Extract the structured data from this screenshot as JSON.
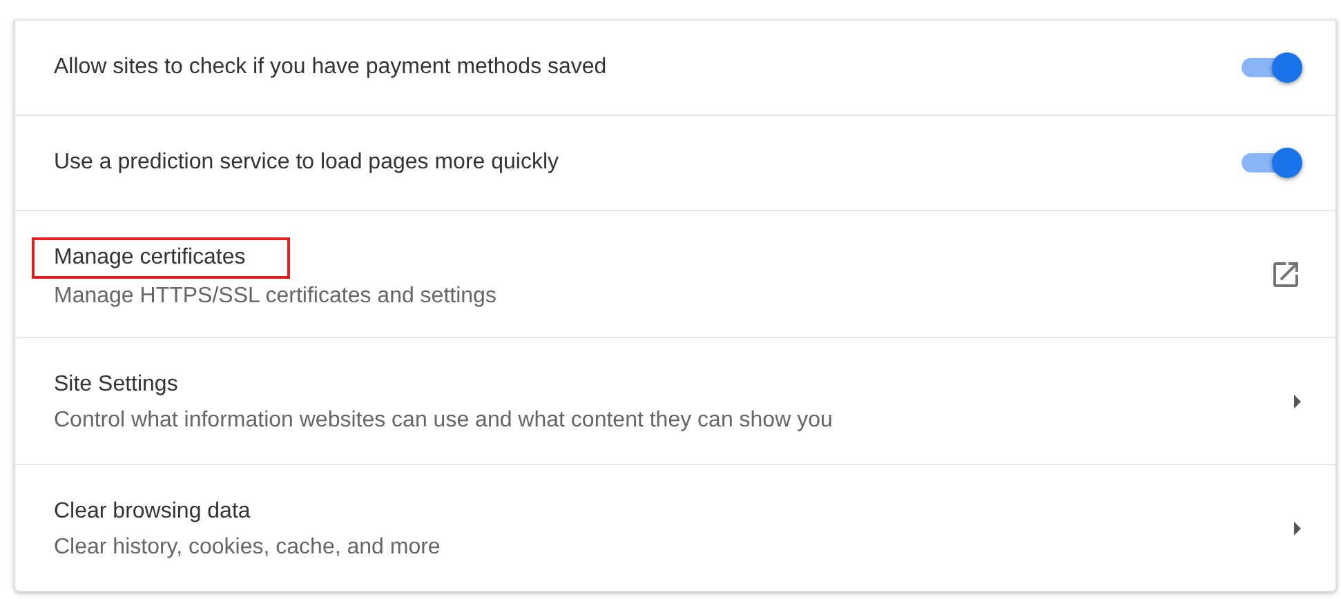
{
  "settings": [
    {
      "kind": "toggle",
      "title": "Allow sites to check if you have payment methods saved",
      "on": true,
      "highlighted": false
    },
    {
      "kind": "toggle",
      "title": "Use a prediction service to load pages more quickly",
      "on": true,
      "highlighted": false
    },
    {
      "kind": "external",
      "title": "Manage certificates",
      "subtitle": "Manage HTTPS/SSL certificates and settings",
      "highlighted": true
    },
    {
      "kind": "arrow",
      "title": "Site Settings",
      "subtitle": "Control what information websites can use and what content they can show you",
      "highlighted": false
    },
    {
      "kind": "arrow",
      "title": "Clear browsing data",
      "subtitle": "Clear history, cookies, cache, and more",
      "highlighted": false
    }
  ]
}
